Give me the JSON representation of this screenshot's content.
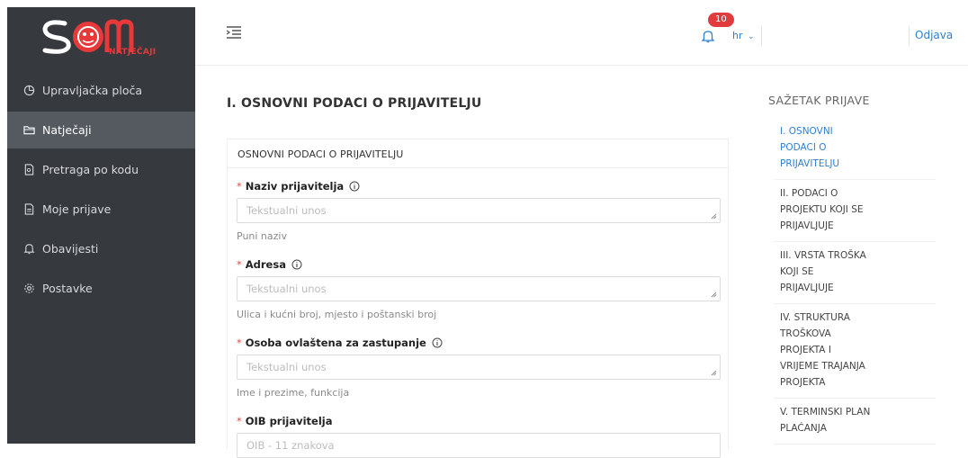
{
  "brand": {
    "name": "SOM",
    "subtitle": "NATJEČAJI"
  },
  "sidebar": {
    "items": [
      {
        "label": "Upravljačka ploča",
        "icon": "dashboard-icon"
      },
      {
        "label": "Natječaji",
        "icon": "folder-icon"
      },
      {
        "label": "Pretraga po kodu",
        "icon": "file-search-icon"
      },
      {
        "label": "Moje prijave",
        "icon": "document-icon"
      },
      {
        "label": "Obavijesti",
        "icon": "bell-icon"
      },
      {
        "label": "Postavke",
        "icon": "gear-icon"
      }
    ]
  },
  "header": {
    "notifications_count": "10",
    "language": "hr",
    "logout_label": "Odjava"
  },
  "main": {
    "title": "I. OSNOVNI PODACI O PRIJAVITELJU",
    "card_title": "OSNOVNI PODACI O PRIJAVITELJU",
    "fields": [
      {
        "label": "Naziv prijavitelja",
        "placeholder": "Tekstualni unos",
        "hint": "Puni naziv"
      },
      {
        "label": "Adresa",
        "placeholder": "Tekstualni unos",
        "hint": "Ulica i kućni broj, mjesto i poštanski broj"
      },
      {
        "label": "Osoba ovlaštena za zastupanje",
        "placeholder": "Tekstualni unos",
        "hint": "Ime i prezime, funkcija"
      },
      {
        "label": "OIB prijavitelja",
        "placeholder": "OIB - 11 znakova",
        "hint": ""
      }
    ]
  },
  "summary": {
    "title": "SAŽETAK PRIJAVE",
    "items": [
      "I. OSNOVNI\nPODACI O\nPRIJAVITELJU",
      "II. PODACI O\nPROJEKTU KOJI SE\nPRIJAVLJUJE",
      "III. VRSTA TROŠKA\nKOJI SE\nPRIJAVLJUJE",
      "IV. STRUKTURA\nTROŠKOVA\nPROJEKTA I\nVRIJEME TRAJANJA\nPROJEKTA",
      "V. TERMINSKI PLAN\nPLAĆANJA"
    ]
  },
  "colors": {
    "sidebar_bg": "#36393e",
    "sidebar_active": "#555a61",
    "accent": "#2f7fd0",
    "brand_red": "#e7383a",
    "badge": "#e23b3e"
  }
}
